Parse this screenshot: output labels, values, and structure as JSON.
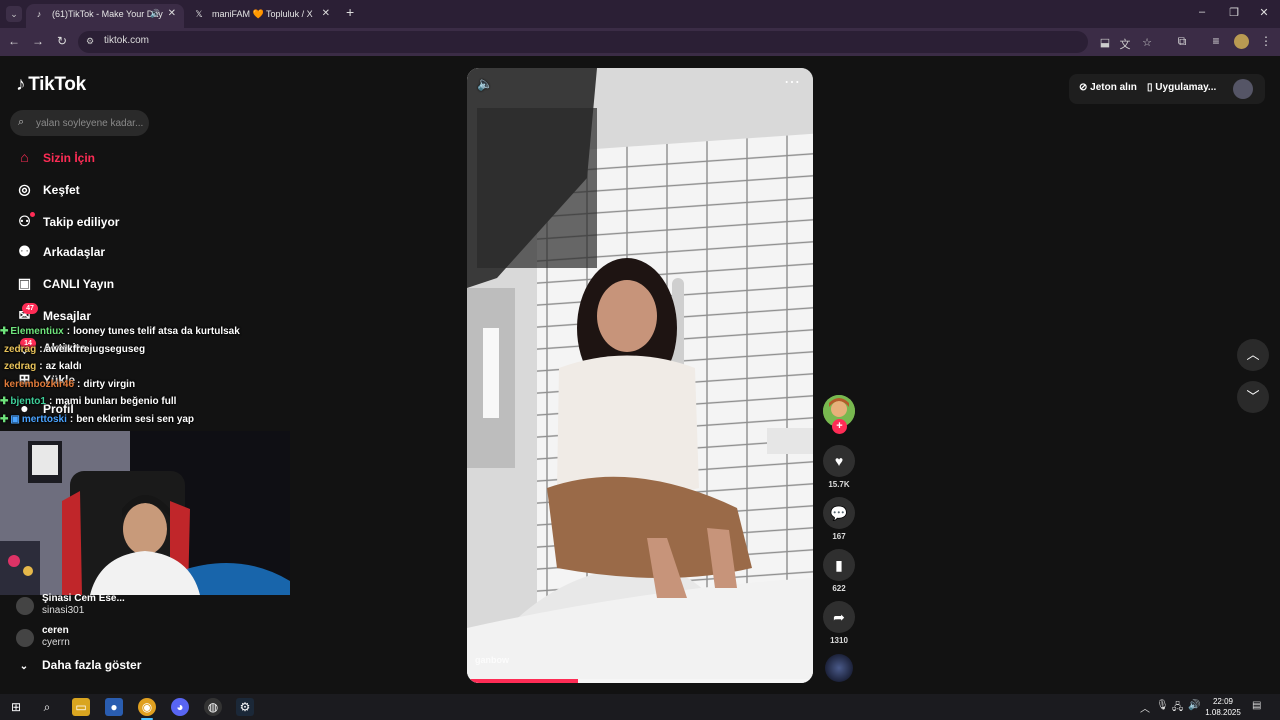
{
  "browser": {
    "tabs": [
      {
        "label": "(61)TikTok - Make Your Day",
        "active": true
      },
      {
        "label": "maniFAM 🧡 Topluluk / X",
        "active": false
      }
    ],
    "url": "tiktok.com",
    "window_controls": {
      "minimize": "–",
      "restore": "❐",
      "close": "✕"
    },
    "new_tab": "+"
  },
  "tiktok": {
    "logo": "TikTok",
    "search": {
      "placeholder": "yalan soyleyene kadar..."
    },
    "nav": [
      {
        "label": "Sizin İçin",
        "icon": "home-icon",
        "active": true
      },
      {
        "label": "Keşfet",
        "icon": "compass-icon"
      },
      {
        "label": "Takip ediliyor",
        "icon": "following-icon"
      },
      {
        "label": "Arkadaşlar",
        "icon": "friends-icon"
      },
      {
        "label": "CANLI Yayın",
        "icon": "live-icon"
      },
      {
        "label": "Mesajlar",
        "icon": "messages-icon",
        "badge": "47"
      },
      {
        "label": "Aktivite",
        "icon": "activity-icon",
        "badge": "14"
      },
      {
        "label": "Yükle",
        "icon": "upload-icon"
      },
      {
        "label": "Profil",
        "icon": "profile-icon"
      }
    ],
    "following": [
      {
        "name": "Şinasi  Cem  Ese...",
        "handle": "sinasi301"
      },
      {
        "name": "ceren",
        "handle": "cyerrn"
      }
    ],
    "show_more": "Daha fazla göster",
    "top_right": {
      "coins": "Jeton alın",
      "app": "Uygulamay..."
    },
    "actions": {
      "likes": "15.7K",
      "comments": "167",
      "saves": "622",
      "shares": "1310"
    },
    "video": {
      "watermark": "ganbow",
      "progress_fraction": 0.32
    },
    "accent": "#fe2c55"
  },
  "chat": [
    {
      "user": "Elementiux",
      "message": "looney tunes telif atsa da kurtulsak",
      "color": "#6fe37c",
      "badge": true
    },
    {
      "user": "zedrag",
      "message": "aweikfrrejugseguseg",
      "color": "#e8c35a",
      "badge": false
    },
    {
      "user": "zedrag",
      "message": "az kaldı",
      "color": "#e8c35a",
      "badge": false
    },
    {
      "user": "kerembozkir46",
      "message": "dirty virgin",
      "color": "#e07a3a",
      "badge": false
    },
    {
      "user": "bjento1",
      "message": "mami bunları beğenio full",
      "color": "#3ecf9a",
      "badge": true
    },
    {
      "user": "merttoski",
      "message": "ben eklerim sesi sen yap",
      "color": "#4aa3ff",
      "badge": true
    }
  ],
  "taskbar": {
    "time": "22:09",
    "date": "1.08.2025"
  }
}
